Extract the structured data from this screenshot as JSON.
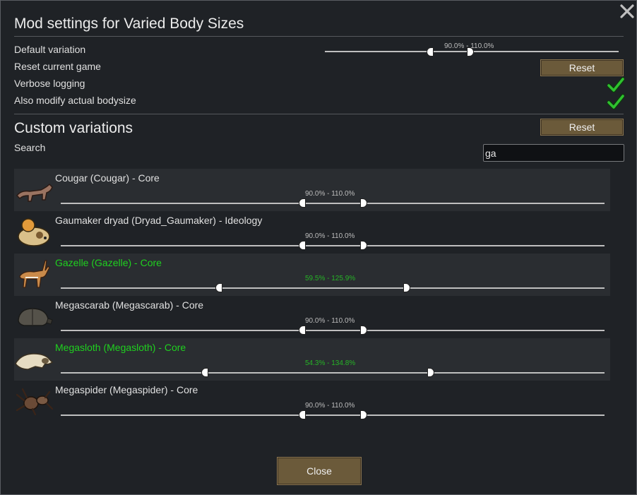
{
  "dialog": {
    "title": "Mod settings for Varied Body Sizes",
    "close_icon": "close-icon"
  },
  "settings": {
    "default_variation_label": "Default variation",
    "default_variation_range": "90.0% - 110.0%",
    "default_variation_min": 90.0,
    "default_variation_max": 110.0,
    "reset_game_label": "Reset current game",
    "reset_button": "Reset",
    "verbose_logging_label": "Verbose logging",
    "verbose_logging_checked": true,
    "modify_bodysize_label": "Also modify actual bodysize",
    "modify_bodysize_checked": true
  },
  "custom": {
    "title": "Custom variations",
    "reset_button": "Reset",
    "search_label": "Search",
    "search_value": "ga"
  },
  "entries": [
    {
      "name": "Cougar (Cougar) - Core",
      "range": "90.0% - 110.0%",
      "min": 90.0,
      "max": 110.0,
      "modified": false,
      "icon": "cougar-icon"
    },
    {
      "name": "Gaumaker dryad (Dryad_Gaumaker) - Ideology",
      "range": "90.0% - 110.0%",
      "min": 90.0,
      "max": 110.0,
      "modified": false,
      "icon": "gaumaker-dryad-icon"
    },
    {
      "name": "Gazelle (Gazelle) - Core",
      "range": "59.5% - 125.9%",
      "min": 59.5,
      "max": 125.9,
      "modified": true,
      "icon": "gazelle-icon"
    },
    {
      "name": "Megascarab (Megascarab) - Core",
      "range": "90.0% - 110.0%",
      "min": 90.0,
      "max": 110.0,
      "modified": false,
      "icon": "megascarab-icon"
    },
    {
      "name": "Megasloth (Megasloth) - Core",
      "range": "54.3% - 134.8%",
      "min": 54.3,
      "max": 134.8,
      "modified": true,
      "icon": "megasloth-icon"
    },
    {
      "name": "Megaspider (Megaspider) - Core",
      "range": "90.0% - 110.0%",
      "min": 90.0,
      "max": 110.0,
      "modified": false,
      "icon": "megaspider-icon"
    }
  ],
  "footer": {
    "close_button": "Close"
  },
  "colors": {
    "accent_green": "#1fd11f",
    "button_brown": "#6b5a3a",
    "checkmark_green": "#2fc12f"
  }
}
